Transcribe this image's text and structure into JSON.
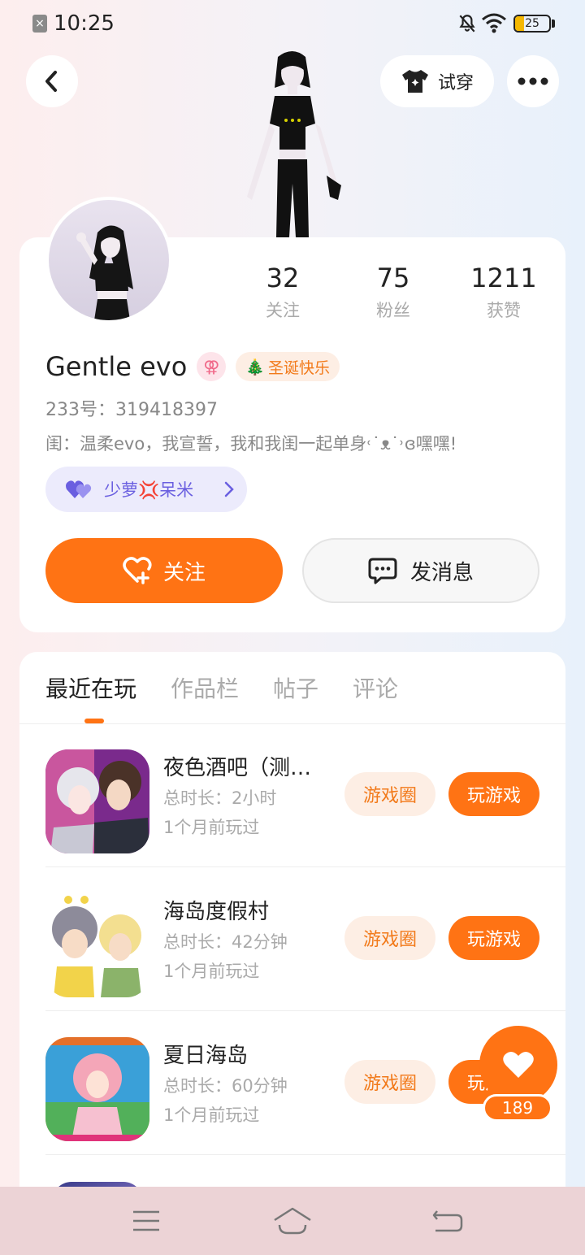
{
  "status_bar": {
    "time": "10:25",
    "battery": "25",
    "battery_level": 0.25,
    "accent": "#f5b800"
  },
  "header": {
    "tryon_label": "试穿"
  },
  "profile": {
    "stats": [
      {
        "value": "32",
        "label": "关注"
      },
      {
        "value": "75",
        "label": "粉丝"
      },
      {
        "value": "1211",
        "label": "获赞"
      }
    ],
    "username": "Gentle evo",
    "gender_symbol": "⚢",
    "badge_icon": "🎄",
    "badge_text": "圣诞快乐",
    "id_line": "233号：319418397",
    "bio": "闺：温柔evo，我宣誓，我和我闺一起单身˓˙ᴥ˙˒ɞ嘿嘿!",
    "cp_name": "少萝💢呆米",
    "follow_label": "关注",
    "message_label": "发消息"
  },
  "tabs": [
    "最近在玩",
    "作品栏",
    "帖子",
    "评论"
  ],
  "games": [
    {
      "title": "夜色酒吧（测…",
      "duration": "总时长：2小时",
      "last_played": "1个月前玩过",
      "circle_label": "游戏圈",
      "play_label": "玩游戏"
    },
    {
      "title": "海岛度假村",
      "duration": "总时长：42分钟",
      "last_played": "1个月前玩过",
      "circle_label": "游戏圈",
      "play_label": "玩游戏"
    },
    {
      "title": "夏日海岛",
      "duration": "总时长：60分钟",
      "last_played": "1个月前玩过",
      "circle_label": "游戏圈",
      "play_label": "玩游戏"
    }
  ],
  "like": {
    "count": "189"
  },
  "colors": {
    "brand_orange": "#ff7314",
    "soft_orange": "#fdeee4",
    "purple": "#6a5fe0"
  }
}
